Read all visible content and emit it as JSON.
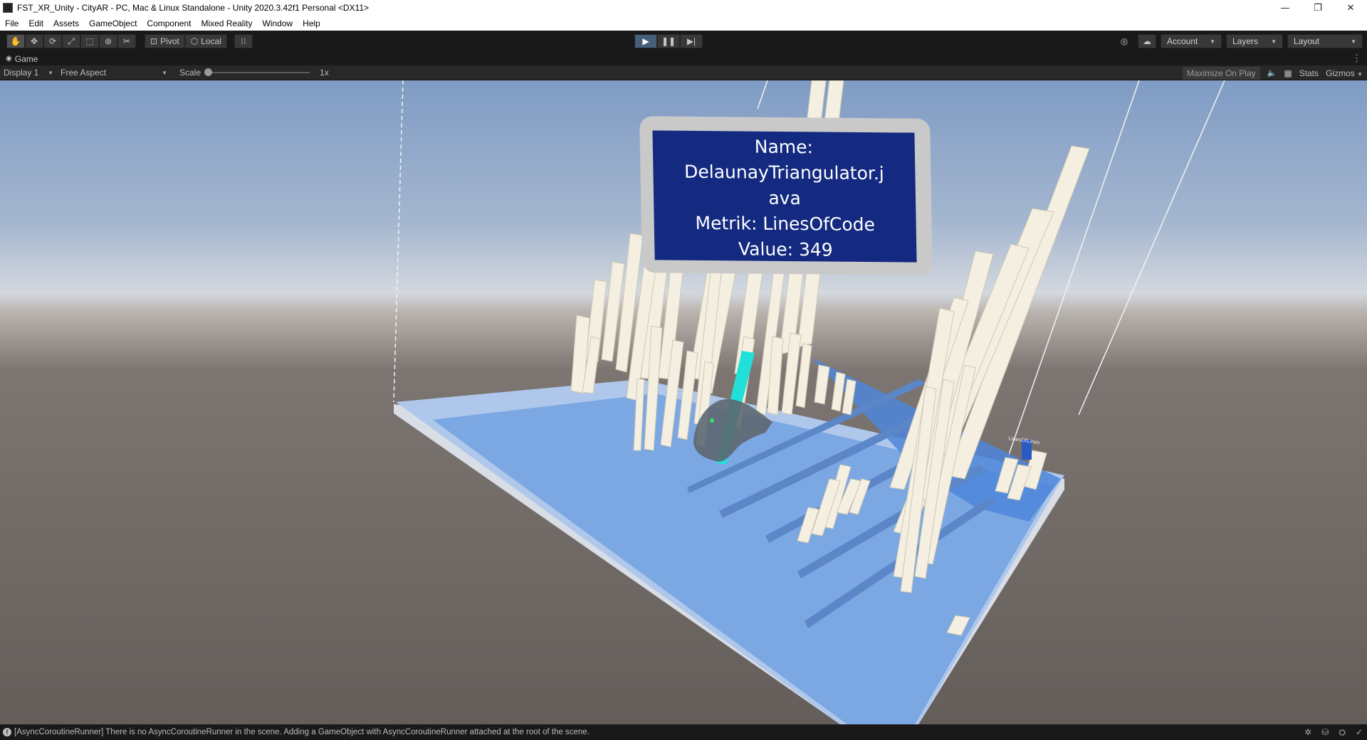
{
  "window": {
    "title": "FST_XR_Unity - CityAR - PC, Mac & Linux Standalone - Unity 2020.3.42f1 Personal <DX11>",
    "minimize_glyph": "—",
    "restore_glyph": "❐",
    "close_glyph": "✕"
  },
  "menu": {
    "items": [
      "File",
      "Edit",
      "Assets",
      "GameObject",
      "Component",
      "Mixed Reality",
      "Window",
      "Help"
    ]
  },
  "toolbar": {
    "tools": [
      {
        "name": "hand-tool",
        "glyph": "✋",
        "icon": "hand-icon"
      },
      {
        "name": "move-tool",
        "glyph": "✥",
        "icon": "move-icon"
      },
      {
        "name": "rotate-tool",
        "glyph": "⟳",
        "icon": "rotate-icon"
      },
      {
        "name": "scale-tool",
        "glyph": "⤢",
        "icon": "scale-icon"
      },
      {
        "name": "rect-tool",
        "glyph": "⬚",
        "icon": "rect-icon"
      },
      {
        "name": "transform-tool",
        "glyph": "⊛",
        "icon": "transform-icon"
      },
      {
        "name": "custom-tool",
        "glyph": "✂",
        "icon": "custom-tool-icon"
      }
    ],
    "pivot_label": "Pivot",
    "local_label": "Local",
    "grid_glyph": "⁝⁝",
    "play_glyph": "▶",
    "pause_glyph": "❚❚",
    "step_glyph": "▶|",
    "services_glyph": "◎",
    "cloud_glyph": "☁",
    "account_label": "Account",
    "layers_label": "Layers",
    "layout_label": "Layout"
  },
  "game_tab": {
    "label": "Game",
    "icon": "gamepad-icon",
    "glyph": "🎮",
    "more_glyph": "⋮"
  },
  "game_bar": {
    "display": "Display 1",
    "aspect": "Free Aspect",
    "scale_label": "Scale",
    "scale_value": "1x",
    "scale_slider": 0.0,
    "maximize_label": "Maximize On Play",
    "mute_glyph": "🔈",
    "stats_glyph": "▦",
    "stats_label": "Stats",
    "gizmos_label": "Gizmos"
  },
  "scene": {
    "tooltip_lines": [
      "Name:",
      "DelaunayTriangulator.j",
      "ava",
      "Metrik: LinesOfCode",
      "Value: 349"
    ],
    "small_label": "LinesOfLines",
    "colors": {
      "sky_top": "#7f9cc4",
      "horizon": "#cfd6e0",
      "ground": "#645e5b",
      "platform": "#7ba7e3",
      "platform_dark": "#4e86db",
      "building": "#f4efe1",
      "panel_bg": "#142a80",
      "highlight": "#20e0d8"
    }
  },
  "status": {
    "message": "[AsyncCoroutineRunner] There is no AsyncCoroutineRunner in the scene. Adding a GameObject with AsyncCoroutineRunner attached at the root of the scene.",
    "info_glyph": "!",
    "right_glyphs": [
      "✲",
      "⛁",
      "⛭",
      "✓"
    ]
  }
}
